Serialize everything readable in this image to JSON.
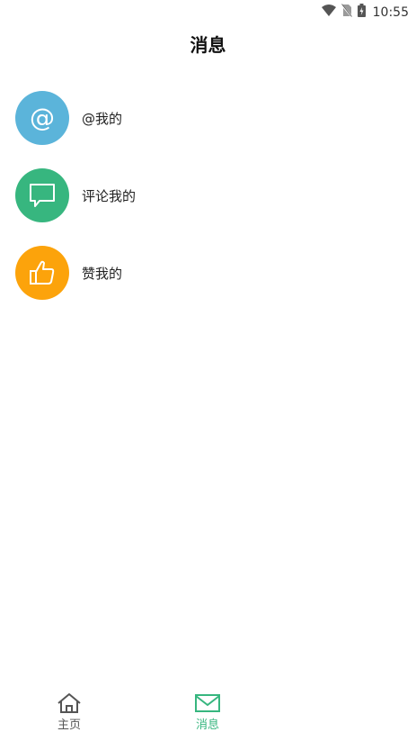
{
  "status_bar": {
    "time": "10:55",
    "icons": [
      "wifi-icon",
      "no-sim-icon",
      "battery-charging-icon"
    ]
  },
  "header": {
    "title": "消息"
  },
  "messages": [
    {
      "label": "@我的",
      "icon": "at-icon",
      "color": "#5bb4da"
    },
    {
      "label": "评论我的",
      "icon": "comment-icon",
      "color": "#37b67f"
    },
    {
      "label": "赞我的",
      "icon": "thumbs-up-icon",
      "color": "#fca30b"
    }
  ],
  "tabbar": {
    "tabs": [
      {
        "label": "主页",
        "icon": "home-icon",
        "active": false,
        "color": "#555555"
      },
      {
        "label": "消息",
        "icon": "envelope-icon",
        "active": true,
        "color": "#37b67f"
      }
    ]
  }
}
